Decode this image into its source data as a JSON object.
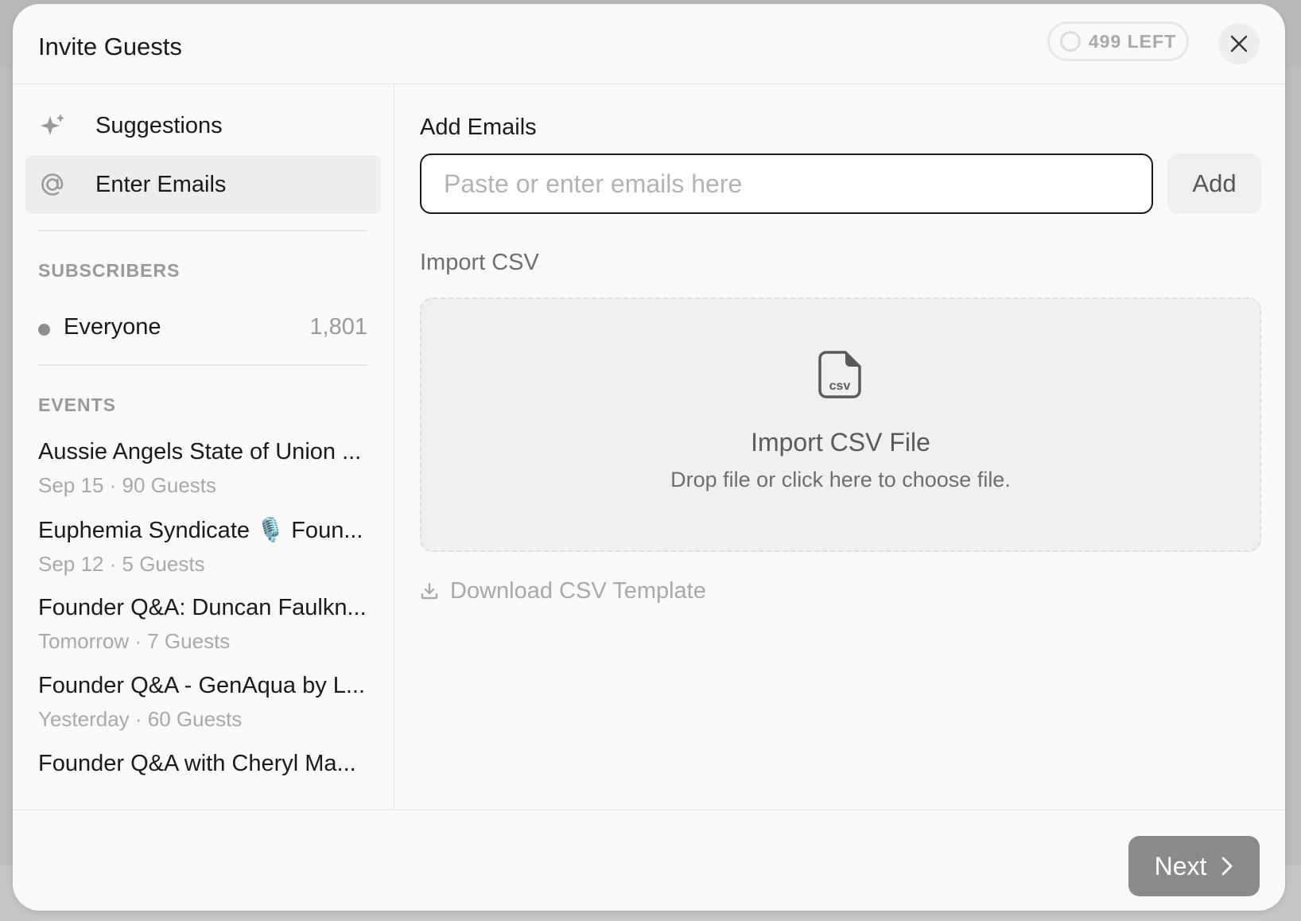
{
  "header": {
    "title": "Invite Guests",
    "remaining_badge": "499 LEFT",
    "close_icon": "close-icon"
  },
  "sidebar": {
    "nav": [
      {
        "label": "Suggestions",
        "icon": "sparkle-icon",
        "active": false
      },
      {
        "label": "Enter Emails",
        "icon": "at-sign-icon",
        "active": true
      }
    ],
    "subscribers_heading": "SUBSCRIBERS",
    "subscribers": [
      {
        "label": "Everyone",
        "count": "1,801"
      }
    ],
    "events_heading": "EVENTS",
    "events": [
      {
        "title": "Aussie Angels State of Union ...",
        "subtitle": "Sep 15 · 90 Guests"
      },
      {
        "title": "Euphemia Syndicate 🎙️ Foun...",
        "subtitle": "Sep 12 · 5 Guests"
      },
      {
        "title": "Founder Q&A: Duncan Faulkn...",
        "subtitle": "Tomorrow · 7 Guests"
      },
      {
        "title": "Founder Q&A - GenAqua by L...",
        "subtitle": "Yesterday · 60 Guests"
      },
      {
        "title": "Founder Q&A with Cheryl Ma...",
        "subtitle": ""
      }
    ]
  },
  "main": {
    "add_emails_heading": "Add Emails",
    "email_input": {
      "value": "",
      "placeholder": "Paste or enter emails here"
    },
    "add_button": "Add",
    "import_heading": "Import CSV",
    "dropzone": {
      "icon": "csv-file-icon",
      "title": "Import CSV File",
      "subtitle": "Drop file or click here to choose file."
    },
    "download_link": "Download CSV Template",
    "download_icon": "download-icon"
  },
  "footer": {
    "next_button": "Next",
    "next_icon": "chevron-right-icon"
  },
  "colors": {
    "primary_button": "#8a8a8a",
    "active_nav": "#ededed",
    "muted_text": "#a9a9a9"
  }
}
